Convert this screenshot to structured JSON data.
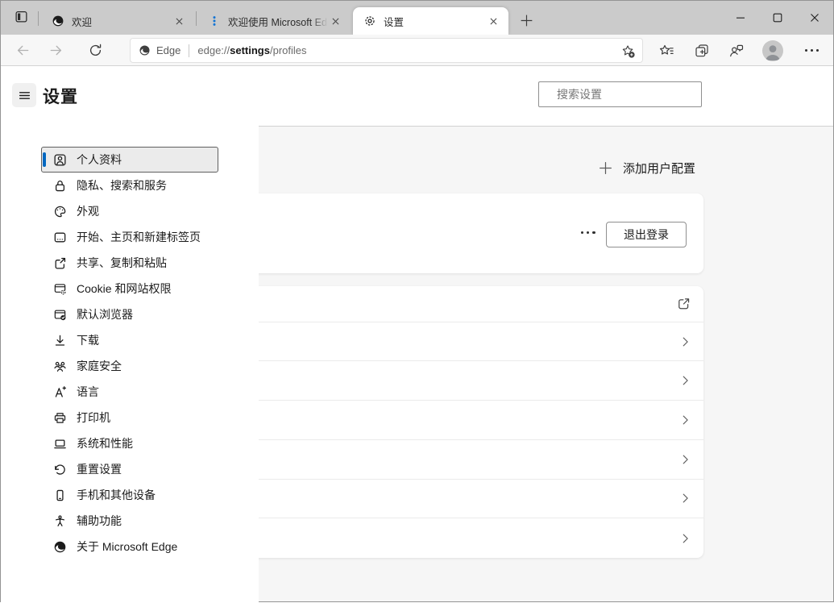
{
  "titlebar": {
    "tabs": [
      {
        "title": "欢迎"
      },
      {
        "title": "欢迎使用 Microsoft Edg"
      },
      {
        "title": "设置"
      }
    ]
  },
  "toolbar": {
    "site_button_label": "Edge",
    "url": {
      "scheme": "edge://",
      "highlighted": "settings",
      "rest": "/profiles"
    }
  },
  "settings_header": {
    "title": "设置",
    "search_placeholder": "搜索设置"
  },
  "sidebar": {
    "items": [
      {
        "label": "个人资料",
        "selected": true
      },
      {
        "label": "隐私、搜索和服务"
      },
      {
        "label": "外观"
      },
      {
        "label": "开始、主页和新建标签页"
      },
      {
        "label": "共享、复制和粘贴"
      },
      {
        "label": "Cookie 和网站权限"
      },
      {
        "label": "默认浏览器"
      },
      {
        "label": "下载"
      },
      {
        "label": "家庭安全"
      },
      {
        "label": "语言"
      },
      {
        "label": "打印机"
      },
      {
        "label": "系统和性能"
      },
      {
        "label": "重置设置"
      },
      {
        "label": "手机和其他设备"
      },
      {
        "label": "辅助功能"
      },
      {
        "label": "关于 Microsoft Edge"
      }
    ]
  },
  "profiles_page": {
    "add_profile_label": "添加用户配置",
    "sign_out_label": "退出登录"
  },
  "colors": {
    "accent_blue": "#0067c0",
    "tab2_favicon_blue": "#1173d4",
    "titlebar_gray": "#cbcbcb",
    "content_gray": "#f6f6f6"
  }
}
